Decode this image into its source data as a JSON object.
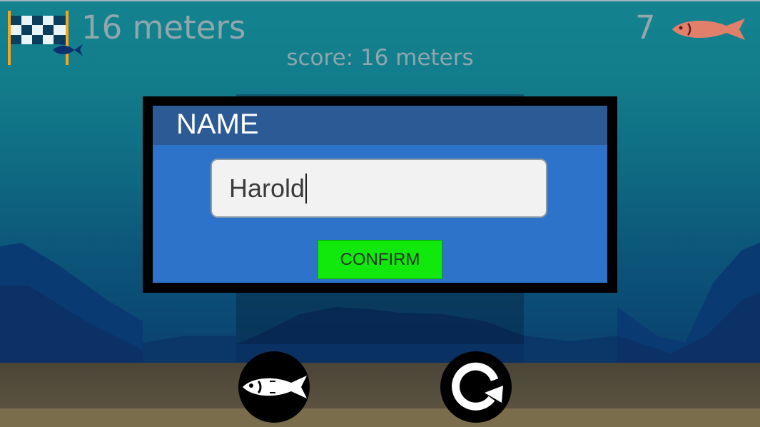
{
  "hud": {
    "distance_text": "16 meters",
    "score_text": "score: 16 meters",
    "fish_count": "7"
  },
  "dialog": {
    "title": "NAME",
    "name_value": "Harold",
    "confirm_label": "CONFIRM"
  },
  "icons": {
    "flag": "checkered-flag-icon",
    "fish_counter": "fish-icon",
    "fish_button": "fish-icon",
    "restart_button": "restart-icon"
  },
  "colors": {
    "confirm_button": "#11e80b",
    "dialog_body": "#2c73c9",
    "dialog_header": "#2b5a94",
    "hud_text": "#8fa7ad"
  }
}
